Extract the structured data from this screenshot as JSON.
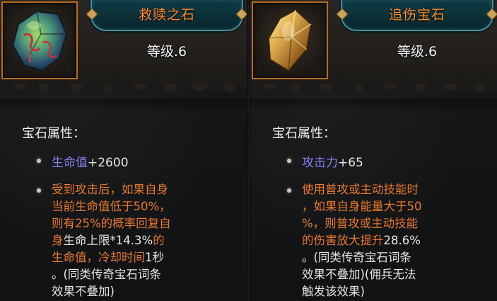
{
  "cards": [
    {
      "name": "救赎之石",
      "level": "等级.6",
      "gem_icon": "green-crystal-gem-icon",
      "attr_title": "宝石属性：",
      "stat": {
        "name": "生命值",
        "value": "+2600"
      },
      "desc_lines": [
        [
          {
            "text": "受到攻击后，如果自身",
            "c": "orange"
          }
        ],
        [
          {
            "text": "当前生命值低于50%，",
            "c": "orange"
          }
        ],
        [
          {
            "text": "则有25%的概率回复自",
            "c": "orange"
          }
        ],
        [
          {
            "text": "身",
            "c": "orange"
          },
          {
            "text": "生命上限*14.3%",
            "c": "white"
          },
          {
            "text": "的",
            "c": "orange"
          }
        ],
        [
          {
            "text": "生命值，冷却时间",
            "c": "orange"
          },
          {
            "text": "1秒",
            "c": "white"
          }
        ],
        [
          {
            "text": "。(同类传奇宝石词条",
            "c": "white"
          }
        ],
        [
          {
            "text": "效果不叠加)",
            "c": "white"
          }
        ]
      ]
    },
    {
      "name": "追伤宝石",
      "level": "等级.6",
      "gem_icon": "gold-crystal-gem-icon",
      "attr_title": "宝石属性：",
      "stat": {
        "name": "攻击力",
        "value": "+65"
      },
      "desc_lines": [
        [
          {
            "text": "使用普攻或主动技能时",
            "c": "orange"
          }
        ],
        [
          {
            "text": "，如果自身能量大于50",
            "c": "orange"
          }
        ],
        [
          {
            "text": "%，则普攻或主动技能",
            "c": "orange"
          }
        ],
        [
          {
            "text": "的伤害放大提升",
            "c": "orange"
          },
          {
            "text": "28.6%",
            "c": "white"
          }
        ],
        [
          {
            "text": "。(同类传奇宝石词条",
            "c": "white"
          }
        ],
        [
          {
            "text": "效果不叠加)(佣兵无法",
            "c": "white"
          }
        ],
        [
          {
            "text": "触发该效果)",
            "c": "white"
          }
        ]
      ]
    }
  ],
  "colors": {
    "orange": "#e8782a",
    "stat_name": "#8a7ff0",
    "name": "#ff8a2a",
    "frame": "#b56a1e"
  }
}
